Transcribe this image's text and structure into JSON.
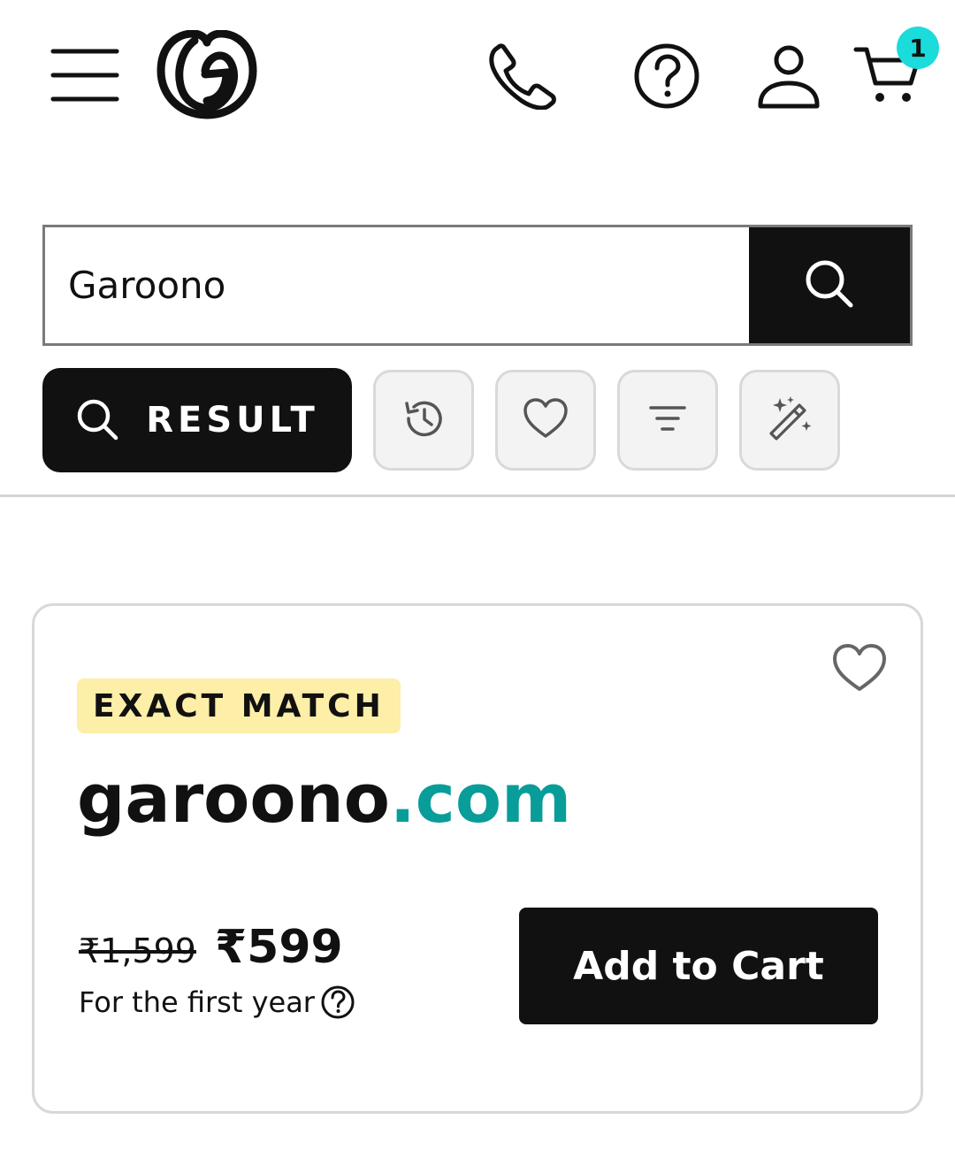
{
  "header": {
    "icons": [
      "menu-icon",
      "godaddy-logo-icon",
      "phone-icon",
      "help-icon",
      "account-icon",
      "cart-icon"
    ],
    "cart_count": "1",
    "colors": {
      "badge": "#1bdbdb"
    }
  },
  "search": {
    "value": "Garoono",
    "button_icon": "search-icon"
  },
  "chips": {
    "result_label": "RESULT",
    "icons": [
      "history-icon",
      "heart-icon",
      "filter-icon",
      "magic-wand-icon"
    ]
  },
  "result_card": {
    "badge": "EXACT MATCH",
    "domain_sld": "garoono",
    "domain_tld": ".com",
    "old_price": "₹1,599",
    "new_price": "₹599",
    "term_note": "For the first year",
    "cta_label": "Add to Cart",
    "colors": {
      "tld": "#099d9a",
      "badge_bg": "#fdeea8",
      "primary": "#111111"
    }
  }
}
